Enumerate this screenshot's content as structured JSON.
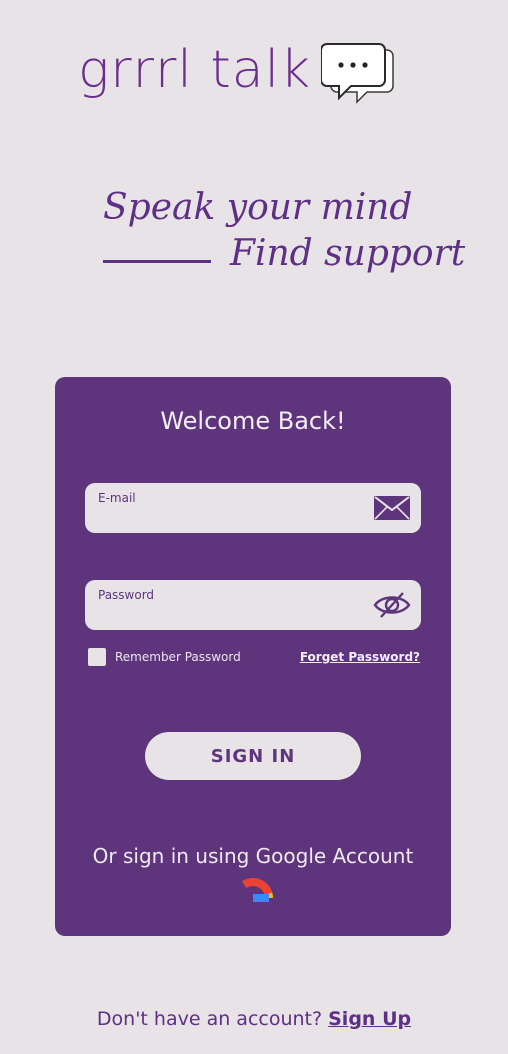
{
  "logo": {
    "text": "grrrl talk",
    "icon": "chat-bubbles-icon"
  },
  "tagline": {
    "line1": "Speak your mind",
    "line2": "Find support"
  },
  "card": {
    "title": "Welcome Back!",
    "email": {
      "label": "E-mail",
      "value": "",
      "icon": "envelope-icon"
    },
    "password": {
      "label": "Password",
      "value": "",
      "icon": "eye-slash-icon"
    },
    "remember_label": "Remember Password",
    "remember_checked": false,
    "forgot_label": "Forget Password?",
    "signin_label": "SIGN IN",
    "google_text": "Or sign in using Google Account",
    "google_icon": "google-icon"
  },
  "footer": {
    "prompt": "Don't have an account?",
    "signup_label": "Sign Up"
  },
  "colors": {
    "background": "#e8e3e6",
    "brand_purple": "#5e357c",
    "logo_purple": "#6b2e8f"
  }
}
